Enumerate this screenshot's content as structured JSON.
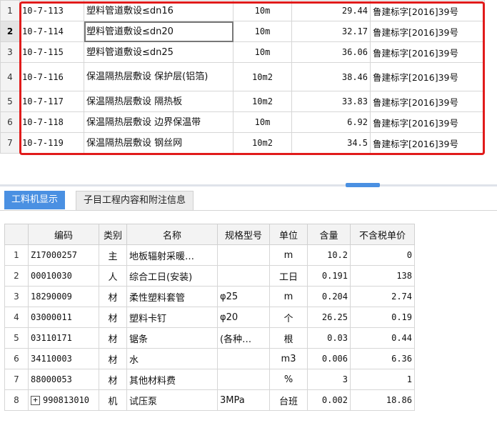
{
  "top_rows": [
    {
      "num": "1",
      "code": "10-7-113",
      "name": "塑料管道敷设≤dn16",
      "unit": "10m",
      "price": "29.44",
      "basis": "鲁建标字[2016]39号"
    },
    {
      "num": "2",
      "code": "10-7-114",
      "name": "塑料管道敷设≤dn20",
      "unit": "10m",
      "price": "32.17",
      "basis": "鲁建标字[2016]39号"
    },
    {
      "num": "3",
      "code": "10-7-115",
      "name": "塑料管道敷设≤dn25",
      "unit": "10m",
      "price": "36.06",
      "basis": "鲁建标字[2016]39号"
    },
    {
      "num": "4",
      "code": "10-7-116",
      "name": "保温隔热层敷设 保护层(铝箔)",
      "unit": "10m2",
      "price": "38.46",
      "basis": "鲁建标字[2016]39号"
    },
    {
      "num": "5",
      "code": "10-7-117",
      "name": "保温隔热层敷设 隔热板",
      "unit": "10m2",
      "price": "33.83",
      "basis": "鲁建标字[2016]39号"
    },
    {
      "num": "6",
      "code": "10-7-118",
      "name": "保温隔热层敷设 边界保温带",
      "unit": "10m",
      "price": "6.92",
      "basis": "鲁建标字[2016]39号"
    },
    {
      "num": "7",
      "code": "10-7-119",
      "name": "保温隔热层敷设 钢丝网",
      "unit": "10m2",
      "price": "34.5",
      "basis": "鲁建标字[2016]39号"
    }
  ],
  "tabs": {
    "labor_machine": "工料机显示",
    "item_content": "子目工程内容和附注信息"
  },
  "bottom_headers": {
    "num": "",
    "code": "编码",
    "type": "类别",
    "name": "名称",
    "spec": "规格型号",
    "unit": "单位",
    "qty": "含量",
    "price": "不含税单价"
  },
  "bottom_rows": [
    {
      "num": "1",
      "code": "Z17000257",
      "type": "主",
      "name": "地板辐射采暖…",
      "spec": "",
      "unit": "m",
      "qty": "10.2",
      "price": "0"
    },
    {
      "num": "2",
      "code": "00010030",
      "type": "人",
      "name": "综合工日(安装)",
      "spec": "",
      "unit": "工日",
      "qty": "0.191",
      "price": "138"
    },
    {
      "num": "3",
      "code": "18290009",
      "type": "材",
      "name": "柔性塑料套管",
      "spec": "φ25",
      "unit": "m",
      "qty": "0.204",
      "price": "2.74"
    },
    {
      "num": "4",
      "code": "03000011",
      "type": "材",
      "name": "塑料卡钉",
      "spec": "φ20",
      "unit": "个",
      "qty": "26.25",
      "price": "0.19"
    },
    {
      "num": "5",
      "code": "03110171",
      "type": "材",
      "name": "锯条",
      "spec": "(各种…",
      "unit": "根",
      "qty": "0.03",
      "price": "0.44"
    },
    {
      "num": "6",
      "code": "34110003",
      "type": "材",
      "name": "水",
      "spec": "",
      "unit": "m3",
      "qty": "0.006",
      "price": "6.36"
    },
    {
      "num": "7",
      "code": "88000053",
      "type": "材",
      "name": "其他材料费",
      "spec": "",
      "unit": "%",
      "qty": "3",
      "price": "1"
    },
    {
      "num": "8",
      "code": "990813010",
      "type": "机",
      "name": "试压泵",
      "spec": "3MPa",
      "unit": "台班",
      "qty": "0.002",
      "price": "18.86",
      "expand": "+"
    }
  ]
}
